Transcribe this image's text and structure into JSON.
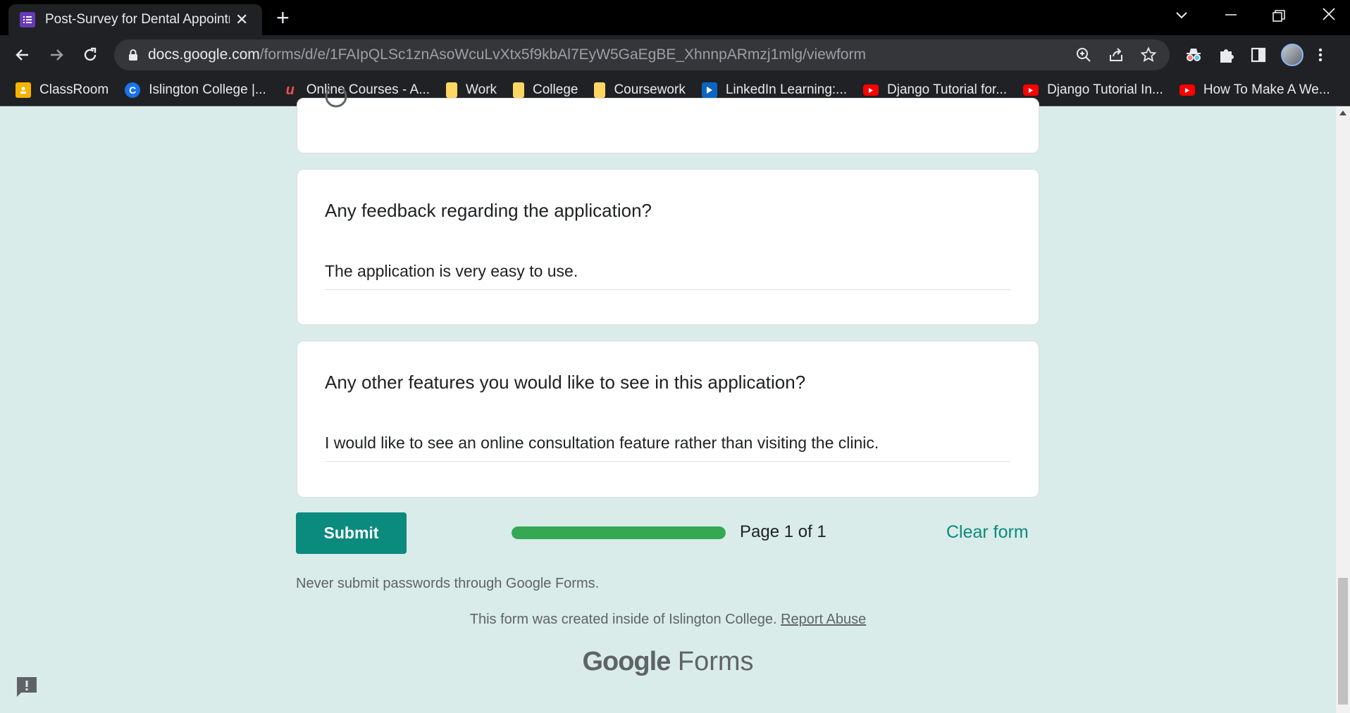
{
  "browser": {
    "tab_title": "Post-Survey for Dental Appointm",
    "url_host": "docs.google.com",
    "url_path": "/forms/d/e/1FAIpQLSc1znAsoWcuLvXtx5f9kbAl7EyW5GaEgBE_XhnnpARmzj1mlg/viewform"
  },
  "bookmarks": [
    {
      "label": "ClassRoom",
      "icon": "google-classroom-icon",
      "color": "#f4b400"
    },
    {
      "label": "Islington College |...",
      "icon": "islington-college-icon",
      "color": "#1a73e8"
    },
    {
      "label": "Online Courses - A...",
      "icon": "udemy-icon",
      "color": "#a435f0"
    },
    {
      "label": "Work",
      "icon": "folder-icon",
      "color": "#fdd663"
    },
    {
      "label": "College",
      "icon": "folder-icon",
      "color": "#fdd663"
    },
    {
      "label": "Coursework",
      "icon": "folder-icon",
      "color": "#fdd663"
    },
    {
      "label": "LinkedIn Learning:...",
      "icon": "linkedin-learning-icon",
      "color": "#0a66c2"
    },
    {
      "label": "Django Tutorial for...",
      "icon": "youtube-icon",
      "color": "#ff0000"
    },
    {
      "label": "Django Tutorial In...",
      "icon": "youtube-icon",
      "color": "#ff0000"
    },
    {
      "label": "How To Make A We...",
      "icon": "youtube-icon",
      "color": "#ff0000"
    }
  ],
  "form": {
    "questions": [
      {
        "title": "Any feedback regarding the application?",
        "answer": "The application is very easy to use."
      },
      {
        "title": "Any other features you would like to see in this application?",
        "answer": "I would like to see an online consultation feature rather than visiting the clinic."
      }
    ],
    "submit_label": "Submit",
    "progress_fraction": 1.0,
    "page_indicator": "Page 1 of 1",
    "clear_label": "Clear form",
    "warning": "Never submit passwords through Google Forms.",
    "footer_text": "This form was created inside of Islington College.",
    "report_link": "Report Abuse",
    "brand_google": "Google",
    "brand_forms": "Forms"
  },
  "colors": {
    "page_bg": "#d9ece9",
    "accent": "#0b8a7e",
    "progress": "#34a853"
  }
}
